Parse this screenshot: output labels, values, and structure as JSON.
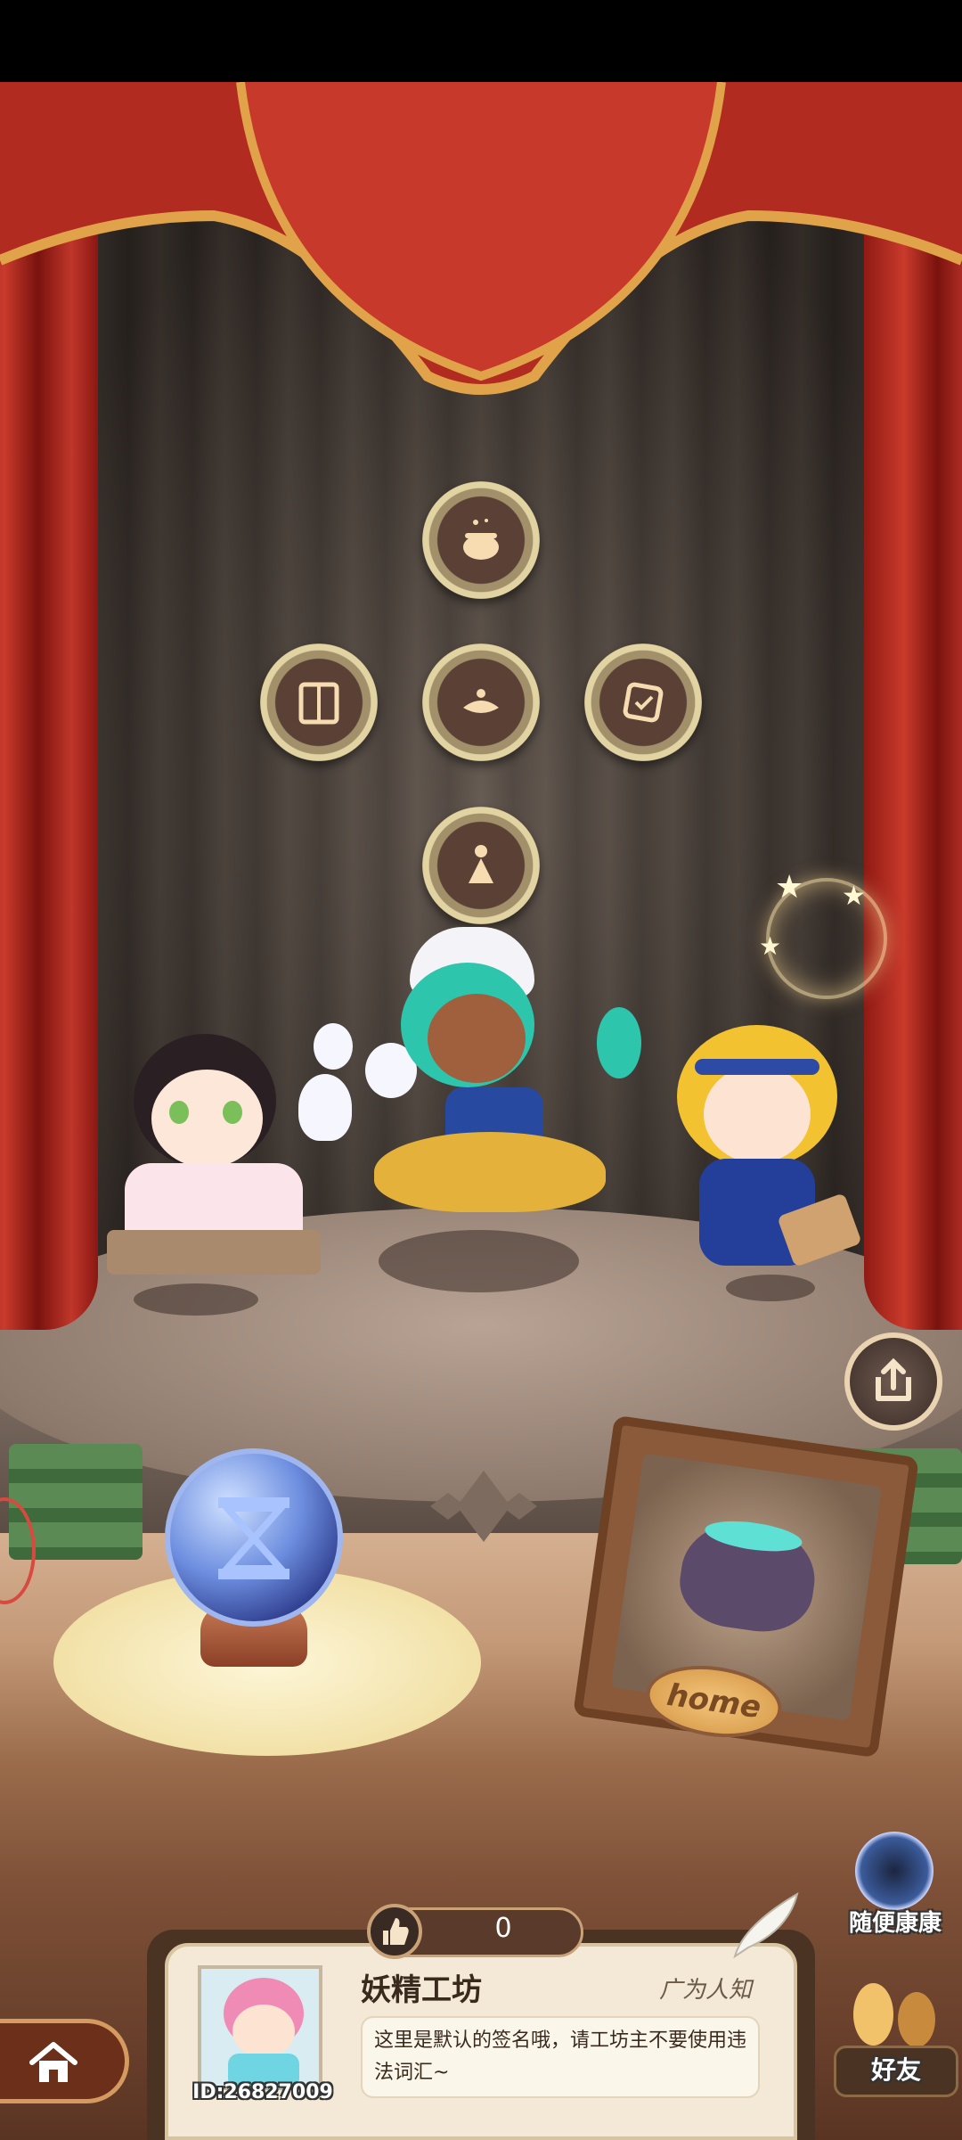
{
  "stage": {
    "skill_icons": [
      "cauldron-icon",
      "book-icon",
      "lamp-icon",
      "scroll-icon",
      "figure-icon"
    ],
    "frame_label": "home",
    "share_icon": "share-icon",
    "hourglass_icon": "hourglass-icon"
  },
  "random_visit": {
    "label": "随便康康"
  },
  "card": {
    "like_count": "0",
    "workshop_name": "妖精工坊",
    "rank": "广为人知",
    "signature": "这里是默认的签名哦，请工坊主不要使用违法词汇~",
    "user_id": "ID:26827009"
  },
  "nav": {
    "home_icon": "home-icon",
    "friends_label": "好友"
  },
  "colors": {
    "curtain": "#c93a2b",
    "stage": "#b8a395",
    "card_bg": "#f3e9d6",
    "accent_gold": "#e2d3a2"
  }
}
